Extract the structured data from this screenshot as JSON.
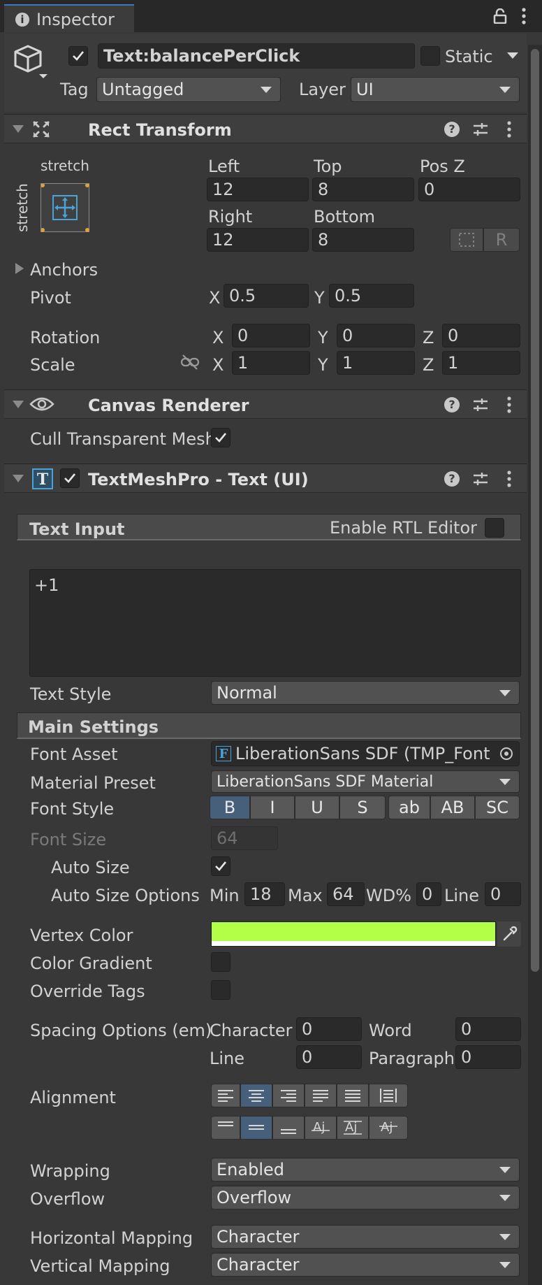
{
  "tab": {
    "title": "Inspector"
  },
  "gameobject": {
    "name": "Text:balancePerClick",
    "static_label": "Static",
    "tag_label": "Tag",
    "tag_value": "Untagged",
    "layer_label": "Layer",
    "layer_value": "UI"
  },
  "rect_transform": {
    "title": "Rect Transform",
    "anchor_h": "stretch",
    "anchor_v": "stretch",
    "left_label": "Left",
    "left": "12",
    "top_label": "Top",
    "top": "8",
    "posz_label": "Pos Z",
    "posz": "0",
    "right_label": "Right",
    "right": "12",
    "bottom_label": "Bottom",
    "bottom": "8",
    "r_button": "R",
    "anchors_label": "Anchors",
    "pivot_label": "Pivot",
    "pivot_x_label": "X",
    "pivot_x": "0.5",
    "pivot_y_label": "Y",
    "pivot_y": "0.5",
    "rotation_label": "Rotation",
    "rot_x_label": "X",
    "rot_x": "0",
    "rot_y_label": "Y",
    "rot_y": "0",
    "rot_z_label": "Z",
    "rot_z": "0",
    "scale_label": "Scale",
    "scale_x_label": "X",
    "scale_x": "1",
    "scale_y_label": "Y",
    "scale_y": "1",
    "scale_z_label": "Z",
    "scale_z": "1"
  },
  "canvas_renderer": {
    "title": "Canvas Renderer",
    "cull_label": "Cull Transparent Mesh"
  },
  "tmp": {
    "title": "TextMeshPro - Text (UI)",
    "text_input_title": "Text Input",
    "rtl_label": "Enable RTL Editor",
    "text_value": "+1",
    "text_style_label": "Text Style",
    "text_style_value": "Normal",
    "main_settings_title": "Main Settings",
    "font_asset_label": "Font Asset",
    "font_asset_value": "LiberationSans SDF (TMP_Font A",
    "material_preset_label": "Material Preset",
    "material_preset_value": "LiberationSans SDF Material",
    "font_style_label": "Font Style",
    "font_style_buttons": [
      "B",
      "I",
      "U",
      "S",
      "ab",
      "AB",
      "SC"
    ],
    "font_size_label": "Font Size",
    "font_size_value": "64",
    "auto_size_label": "Auto Size",
    "auto_size_options_label": "Auto Size Options",
    "min_label": "Min",
    "min_value": "18",
    "max_label": "Max",
    "max_value": "64",
    "wd_label": "WD%",
    "wd_value": "0",
    "line_label": "Line",
    "line_value": "0",
    "vertex_color_label": "Vertex Color",
    "vertex_color": "#b3ff47",
    "color_gradient_label": "Color Gradient",
    "override_tags_label": "Override Tags",
    "spacing_label": "Spacing Options (em)",
    "character_label": "Character",
    "character_value": "0",
    "word_label": "Word",
    "word_value": "0",
    "line_spacing_label": "Line",
    "line_spacing_value": "0",
    "paragraph_label": "Paragraph",
    "paragraph_value": "0",
    "alignment_label": "Alignment",
    "wrapping_label": "Wrapping",
    "wrapping_value": "Enabled",
    "overflow_label": "Overflow",
    "overflow_value": "Overflow",
    "h_mapping_label": "Horizontal Mapping",
    "h_mapping_value": "Character",
    "v_mapping_label": "Vertical Mapping",
    "v_mapping_value": "Character"
  },
  "colors": {
    "accent": "#46607c",
    "panel": "#383838",
    "field": "#2a2a2a"
  }
}
